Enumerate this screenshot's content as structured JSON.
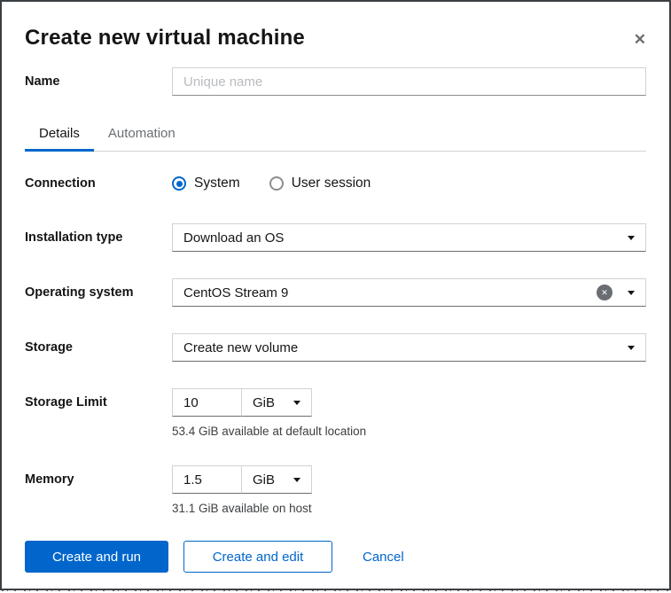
{
  "dialog": {
    "title": "Create new virtual machine",
    "close_icon": "✕"
  },
  "form": {
    "name": {
      "label": "Name",
      "value": "",
      "placeholder": "Unique name"
    },
    "tabs": [
      {
        "label": "Details",
        "active": true
      },
      {
        "label": "Automation",
        "active": false
      }
    ],
    "connection": {
      "label": "Connection",
      "options": [
        {
          "label": "System",
          "selected": true
        },
        {
          "label": "User session",
          "selected": false
        }
      ]
    },
    "installation_type": {
      "label": "Installation type",
      "value": "Download an OS"
    },
    "operating_system": {
      "label": "Operating system",
      "value": "CentOS Stream 9",
      "clearable": true
    },
    "storage": {
      "label": "Storage",
      "value": "Create new volume"
    },
    "storage_limit": {
      "label": "Storage Limit",
      "value": "10",
      "unit": "GiB",
      "helper": "53.4 GiB available at default location"
    },
    "memory": {
      "label": "Memory",
      "value": "1.5",
      "unit": "GiB",
      "helper": "31.1 GiB available on host"
    }
  },
  "footer": {
    "create_and_run": "Create and run",
    "create_and_edit": "Create and edit",
    "cancel": "Cancel"
  },
  "colors": {
    "accent": "#0066cc",
    "label_text": "#151515",
    "muted_text": "#6a6e73",
    "input_border": "#d2d2d2",
    "input_border_bottom": "#6a6e73",
    "dialog_border": "#3c3f42"
  }
}
